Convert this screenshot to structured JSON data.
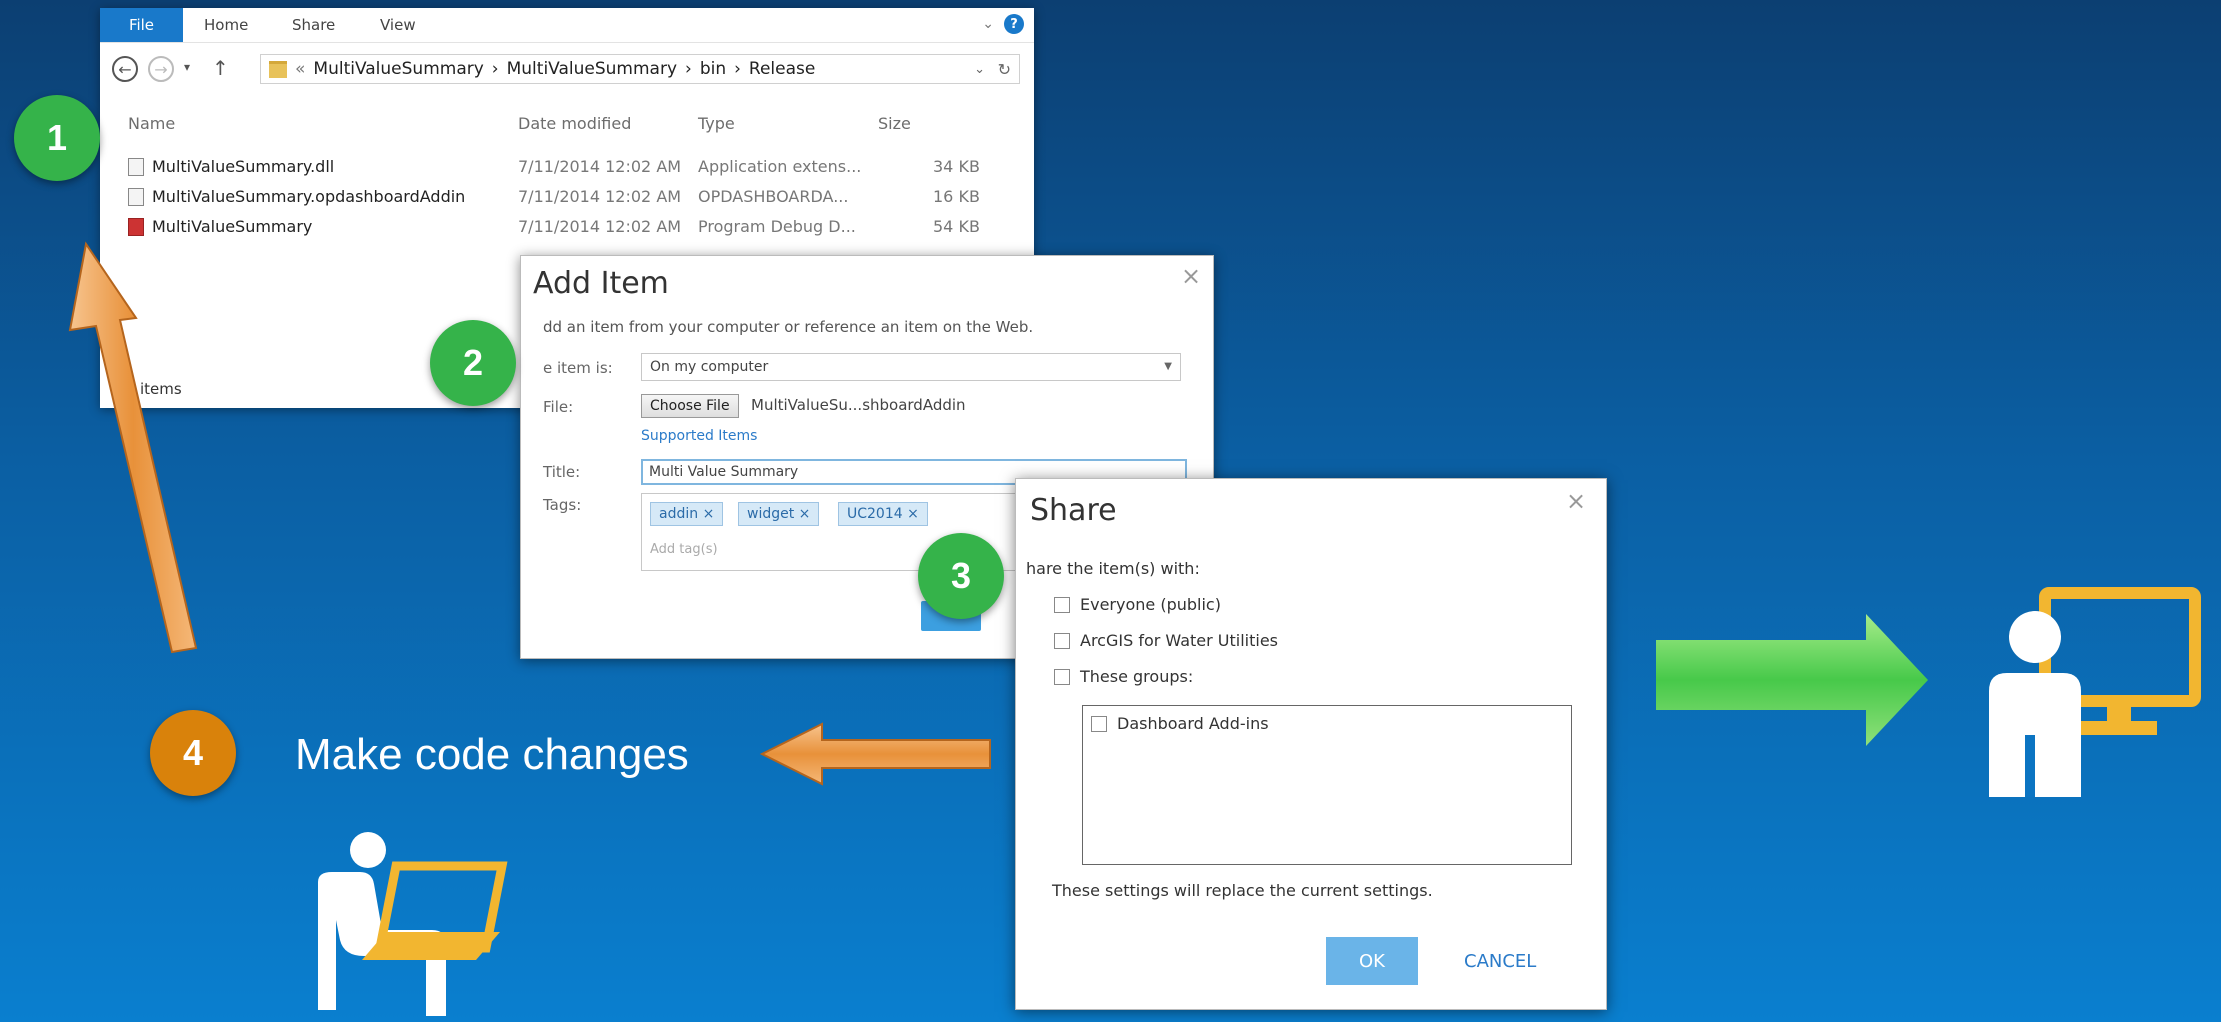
{
  "explorer": {
    "tabs": [
      "File",
      "Home",
      "Share",
      "View"
    ],
    "breadcrumb": [
      "«",
      "MultiValueSummary",
      "›",
      "MultiValueSummary",
      "›",
      "bin",
      "›",
      "Release"
    ],
    "columns": [
      "Name",
      "Date modified",
      "Type",
      "Size"
    ],
    "files": [
      {
        "name": "MultiValueSummary.dll",
        "date": "7/11/2014 12:02 AM",
        "type": "Application extens...",
        "size": "34 KB"
      },
      {
        "name": "MultiValueSummary.opdashboardAddin",
        "date": "7/11/2014 12:02 AM",
        "type": "OPDASHBOARDA...",
        "size": "16 KB"
      },
      {
        "name": "MultiValueSummary",
        "date": "7/11/2014 12:02 AM",
        "type": "Program Debug D...",
        "size": "54 KB"
      }
    ],
    "footer": "items"
  },
  "add_item": {
    "title": "Add Item",
    "intro": "dd an item from your computer or reference an item on the Web.",
    "labels": {
      "source": "e item is:",
      "file": "File:",
      "title": "Title:",
      "tags": "Tags:"
    },
    "source_value": "On my computer",
    "choose_file": "Choose File",
    "file_name": "MultiValueSu...shboardAddin",
    "supported": "Supported Items",
    "title_value": "Multi Value Summary",
    "tags": [
      "addin ×",
      "widget ×",
      "UC2014 ×"
    ],
    "tag_placeholder": "Add tag(s)"
  },
  "share": {
    "title": "Share",
    "intro": "hare the item(s) with:",
    "options": [
      "Everyone (public)",
      "ArcGIS for Water Utilities",
      "These groups:"
    ],
    "groups": [
      "Dashboard Add-ins"
    ],
    "note": "These settings will replace the current settings.",
    "ok": "OK",
    "cancel": "CANCEL"
  },
  "steps": {
    "s1": "1",
    "s2": "2",
    "s3": "3",
    "s4": "4",
    "s4_text": "Make code  changes"
  },
  "colors": {
    "green": "#35b34a",
    "orange": "#d9820b",
    "accent": "#1979ca",
    "icon_yellow": "#f2b630"
  }
}
